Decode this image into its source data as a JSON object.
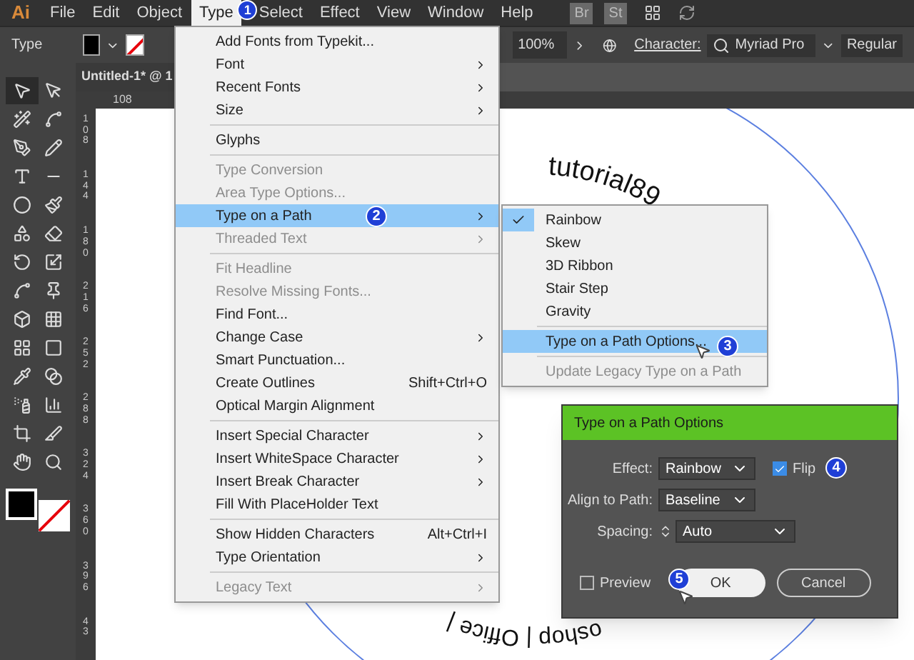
{
  "app_logo": "Ai",
  "menubar": [
    {
      "label": "File",
      "selected": false
    },
    {
      "label": "Edit",
      "selected": false
    },
    {
      "label": "Object",
      "selected": false
    },
    {
      "label": "Type",
      "selected": true
    },
    {
      "label": "Select",
      "selected": false
    },
    {
      "label": "Effect",
      "selected": false
    },
    {
      "label": "View",
      "selected": false
    },
    {
      "label": "Window",
      "selected": false
    },
    {
      "label": "Help",
      "selected": false
    }
  ],
  "app_buttons": [
    "Br",
    "St"
  ],
  "control_bar": {
    "label": "Type",
    "zoom": "100%",
    "character_link": "Character:",
    "font": "Myriad Pro",
    "style": "Regular"
  },
  "document_tab": "Untitled-1* @ 1",
  "ruler": {
    "horizontal": "108",
    "vertical": [
      "108",
      "144",
      "180",
      "216",
      "252",
      "288",
      "324",
      "360",
      "396",
      "43"
    ]
  },
  "tools": [
    {
      "kind": "select",
      "selected": true
    },
    {
      "kind": "direct",
      "selected": false
    },
    {
      "kind": "wand",
      "selected": false
    },
    {
      "kind": "lasso",
      "selected": false
    },
    {
      "kind": "pen",
      "selected": false
    },
    {
      "kind": "curvature",
      "selected": false
    },
    {
      "kind": "type",
      "selected": false
    },
    {
      "kind": "line",
      "selected": false
    },
    {
      "kind": "ellipse",
      "selected": false
    },
    {
      "kind": "brush",
      "selected": false
    },
    {
      "kind": "shaper",
      "selected": false
    },
    {
      "kind": "eraser",
      "selected": false
    },
    {
      "kind": "rotate",
      "selected": false
    },
    {
      "kind": "scale",
      "selected": false
    },
    {
      "kind": "warp",
      "selected": false
    },
    {
      "kind": "pin",
      "selected": false
    },
    {
      "kind": "shapebuilder",
      "selected": false
    },
    {
      "kind": "perspective",
      "selected": false
    },
    {
      "kind": "mesh",
      "selected": false
    },
    {
      "kind": "gradient",
      "selected": false
    },
    {
      "kind": "eyedropper",
      "selected": false
    },
    {
      "kind": "blend",
      "selected": false
    },
    {
      "kind": "symbol",
      "selected": false
    },
    {
      "kind": "graph",
      "selected": false
    },
    {
      "kind": "artboard",
      "selected": false
    },
    {
      "kind": "slice",
      "selected": false
    },
    {
      "kind": "hand",
      "selected": false
    },
    {
      "kind": "zoom",
      "selected": false
    }
  ],
  "canvas_text": {
    "top": "tutorial89",
    "bottom": "oshop | Office |"
  },
  "type_menu": [
    {
      "kind": "item",
      "label": "Add Fonts from Typekit...",
      "disabled": false,
      "submenu": false,
      "selected": false
    },
    {
      "kind": "item",
      "label": "Font",
      "disabled": false,
      "submenu": true,
      "selected": false
    },
    {
      "kind": "item",
      "label": "Recent Fonts",
      "disabled": false,
      "submenu": true,
      "selected": false
    },
    {
      "kind": "item",
      "label": "Size",
      "disabled": false,
      "submenu": true,
      "selected": false
    },
    {
      "kind": "separator"
    },
    {
      "kind": "item",
      "label": "Glyphs",
      "disabled": false,
      "submenu": false,
      "selected": false
    },
    {
      "kind": "separator"
    },
    {
      "kind": "item",
      "label": "Type Conversion",
      "disabled": true,
      "submenu": false,
      "selected": false
    },
    {
      "kind": "item",
      "label": "Area Type Options...",
      "disabled": true,
      "submenu": false,
      "selected": false
    },
    {
      "kind": "item",
      "label": "Type on a Path",
      "disabled": false,
      "submenu": true,
      "selected": true
    },
    {
      "kind": "item",
      "label": "Threaded Text",
      "disabled": true,
      "submenu": true,
      "selected": false
    },
    {
      "kind": "separator"
    },
    {
      "kind": "item",
      "label": "Fit Headline",
      "disabled": true,
      "submenu": false,
      "selected": false
    },
    {
      "kind": "item",
      "label": "Resolve Missing Fonts...",
      "disabled": true,
      "submenu": false,
      "selected": false
    },
    {
      "kind": "item",
      "label": "Find Font...",
      "disabled": false,
      "submenu": false,
      "selected": false
    },
    {
      "kind": "item",
      "label": "Change Case",
      "disabled": false,
      "submenu": true,
      "selected": false
    },
    {
      "kind": "item",
      "label": "Smart Punctuation...",
      "disabled": false,
      "submenu": false,
      "selected": false
    },
    {
      "kind": "item",
      "label": "Create Outlines",
      "shortcut": "Shift+Ctrl+O",
      "disabled": false,
      "submenu": false,
      "selected": false
    },
    {
      "kind": "item",
      "label": "Optical Margin Alignment",
      "disabled": false,
      "submenu": false,
      "selected": false
    },
    {
      "kind": "separator"
    },
    {
      "kind": "item",
      "label": "Insert Special Character",
      "disabled": false,
      "submenu": true,
      "selected": false
    },
    {
      "kind": "item",
      "label": "Insert WhiteSpace Character",
      "disabled": false,
      "submenu": true,
      "selected": false
    },
    {
      "kind": "item",
      "label": "Insert Break Character",
      "disabled": false,
      "submenu": true,
      "selected": false
    },
    {
      "kind": "item",
      "label": "Fill With PlaceHolder Text",
      "disabled": false,
      "submenu": false,
      "selected": false
    },
    {
      "kind": "separator"
    },
    {
      "kind": "item",
      "label": "Show Hidden Characters",
      "shortcut": "Alt+Ctrl+I",
      "disabled": false,
      "submenu": false,
      "selected": false
    },
    {
      "kind": "item",
      "label": "Type Orientation",
      "disabled": false,
      "submenu": true,
      "selected": false
    },
    {
      "kind": "separator"
    },
    {
      "kind": "item",
      "label": "Legacy Text",
      "disabled": true,
      "submenu": true,
      "selected": false
    }
  ],
  "path_submenu": [
    {
      "kind": "item",
      "label": "Rainbow",
      "checked": true,
      "disabled": false,
      "selected": false
    },
    {
      "kind": "item",
      "label": "Skew",
      "checked": false,
      "disabled": false,
      "selected": false
    },
    {
      "kind": "item",
      "label": "3D Ribbon",
      "checked": false,
      "disabled": false,
      "selected": false
    },
    {
      "kind": "item",
      "label": "Stair Step",
      "checked": false,
      "disabled": false,
      "selected": false
    },
    {
      "kind": "item",
      "label": "Gravity",
      "checked": false,
      "disabled": false,
      "selected": false
    },
    {
      "kind": "separator"
    },
    {
      "kind": "item",
      "label": "Type on a Path Options...",
      "checked": false,
      "disabled": false,
      "selected": true
    },
    {
      "kind": "separator"
    },
    {
      "kind": "item",
      "label": "Update Legacy Type on a Path",
      "checked": false,
      "disabled": true,
      "selected": false
    }
  ],
  "dialog": {
    "title": "Type on a Path Options",
    "effect_label": "Effect:",
    "effect": "Rainbow",
    "flip_label": "Flip",
    "flip": true,
    "align_label": "Align to Path:",
    "align": "Baseline",
    "spacing_label": "Spacing:",
    "spacing": "Auto",
    "preview_label": "Preview",
    "preview": false,
    "ok": "OK",
    "cancel": "Cancel"
  },
  "callouts": [
    "1",
    "2",
    "3",
    "4",
    "5"
  ]
}
